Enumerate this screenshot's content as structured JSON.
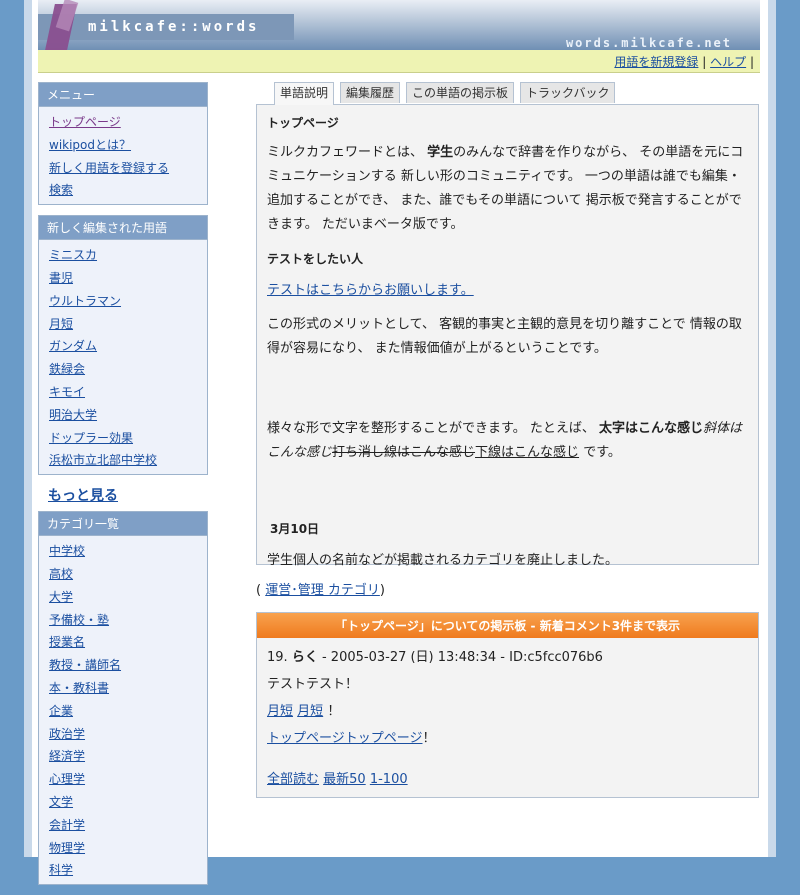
{
  "header": {
    "logo": "milkcafe::words",
    "url": "words.milkcafe.net"
  },
  "top_links": {
    "register": "用語を新規登録",
    "help": "ヘルプ"
  },
  "sidebar": {
    "menu": {
      "title": "メニュー",
      "items": [
        "トップページ",
        "wikipodとは？",
        "新しく用語を登録する",
        "検索"
      ]
    },
    "recent": {
      "title": "新しく編集された用語",
      "items": [
        "ミニスカ",
        "書児",
        "ウルトラマン",
        "月短",
        "ガンダム",
        "鉄緑会",
        "キモイ",
        "明治大学",
        "ドップラー効果",
        "浜松市立北部中学校"
      ]
    },
    "more": "もっと見る",
    "categories": {
      "title": "カテゴリ一覧",
      "items": [
        "中学校",
        "高校",
        "大学",
        "予備校・塾",
        "授業名",
        "教授・講師名",
        "本・教科書",
        "企業",
        "政治学",
        "経済学",
        "心理学",
        "文学",
        "会計学",
        "物理学",
        "科学"
      ]
    }
  },
  "tabs": [
    "単語説明",
    "編集履歴",
    "この単語の掲示板",
    "トラックバック"
  ],
  "article": {
    "title": "トップページ",
    "intro_1": "ミルクカフェワードとは、",
    "intro_bold": "学生",
    "intro_2": "のみんなで辞書を作りながら、 その単語を元にコミュニケーションする 新しい形のコミュニティです。 一つの単語は誰でも編集・追加することができ、 また、誰でもその単語について 掲示板で発言することができます。 ただいまベータ版です。",
    "test_heading": "テストをしたい人",
    "test_link": "テストはこちらからお願いします。",
    "merit": "この形式のメリットとして、 客観的事実と主観的意見を切り離すことで 情報の取得が容易になり、 また情報価値が上がるということです。",
    "format_1": "様々な形で文字を整形することができます。 たとえば、",
    "format_bold": "太字はこんな感じ",
    "format_italic": "斜体はこんな感じ",
    "format_strike": "打ち消し線はこんな感じ",
    "format_under": "下線はこんな感じ",
    "format_end": "です。",
    "date_heading": "3月10日",
    "notice": "学生個人の名前などが掲載されるカテゴリを廃止しました。"
  },
  "category_line": {
    "open": "(",
    "link": "運営･管理 カテゴリ",
    "close": ")"
  },
  "board": {
    "title": "「トップページ」についての掲示板 - 新着コメント3件まで表示",
    "post_num": "19.",
    "post_name": "らく",
    "post_meta": "- 2005-03-27 (日) 13:48:34 - ID:c5fcc076b6",
    "post_text": "テストテスト！",
    "link_a": "月短",
    "link_b": "月短",
    "after_links": "！",
    "link_c": "トップページトップページ",
    "after_c": "！",
    "nav_all": "全部読む",
    "nav_latest": "最新50",
    "nav_range": "1-100"
  }
}
